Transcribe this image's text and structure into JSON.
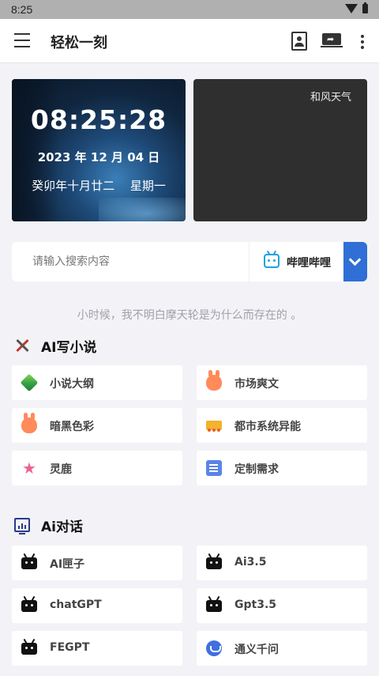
{
  "status_bar": {
    "time": "8:25"
  },
  "app_bar": {
    "title": "轻松一刻"
  },
  "clock_card": {
    "time": "08:25:28",
    "date": "2023 年 12 月 04 日",
    "lunar": "癸卯年十月廿二　 星期一"
  },
  "weather_card": {
    "label": "和风天气"
  },
  "search": {
    "placeholder": "请输入搜索内容",
    "engine": "哔哩哔哩",
    "accent_color": "#2f6fd6"
  },
  "quote": "小时候，我不明白摩天轮是为什么而存在的 。",
  "sections": [
    {
      "title": "AI写小说",
      "icon": "tools-icon",
      "items": [
        {
          "label": "小说大纲",
          "icon": "cube-icon"
        },
        {
          "label": "市场爽文",
          "icon": "bunny-icon"
        },
        {
          "label": "暗黑色彩",
          "icon": "bunny-icon"
        },
        {
          "label": "都市系统异能",
          "icon": "truck-icon"
        },
        {
          "label": "灵鹿",
          "icon": "star-icon"
        },
        {
          "label": "定制需求",
          "icon": "doc-icon"
        }
      ]
    },
    {
      "title": "Ai对话",
      "icon": "monitor-icon",
      "items": [
        {
          "label": "AI匣子",
          "icon": "tv-icon"
        },
        {
          "label": "Ai3.5",
          "icon": "tv-icon"
        },
        {
          "label": "chatGPT",
          "icon": "tv-icon"
        },
        {
          "label": "Gpt3.5",
          "icon": "tv-icon"
        },
        {
          "label": "FEGPT",
          "icon": "tv-icon"
        },
        {
          "label": "通义千问",
          "icon": "cloud-icon"
        }
      ]
    }
  ]
}
